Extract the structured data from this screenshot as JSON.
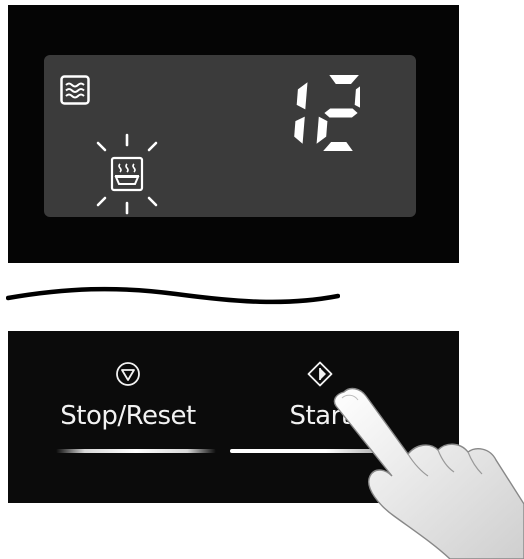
{
  "display": {
    "timer_value": "12",
    "mode_icon": "microwave-waves-icon",
    "indicator_icon": "steam-dish-icon"
  },
  "controls": {
    "stop_label": "Stop/Reset",
    "stop_icon": "stop-icon",
    "start_label": "Start",
    "start_icon": "start-icon"
  },
  "colors": {
    "panel": "#050505",
    "lcd_background": "#3b3b3b",
    "segment_lit": "#ffffff",
    "control_panel": "#0b0b0b"
  }
}
